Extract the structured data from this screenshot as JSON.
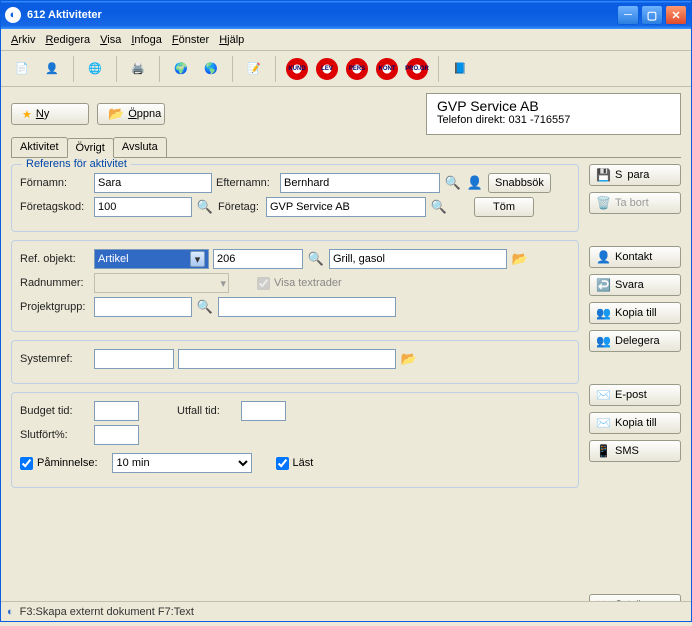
{
  "window": {
    "title": "612 Aktiviteter"
  },
  "menu": {
    "arkiv": "Arkiv",
    "redigera": "Redigera",
    "visa": "Visa",
    "infoga": "Infoga",
    "fonster": "Fönster",
    "hjalp": "Hjälp"
  },
  "toolbar_badges": [
    "KUND",
    "LEV",
    "PERS",
    "KONT",
    "PRO.GR"
  ],
  "topbuttons": {
    "ny": "Ny",
    "oppna": "Öppna"
  },
  "company": {
    "name": "GVP Service AB",
    "phone": "Telefon direkt:  031 -716557"
  },
  "tabs": {
    "aktivitet": "Aktivitet",
    "ovrigt": "Övrigt",
    "avsluta": "Avsluta"
  },
  "ref": {
    "legend": "Referens för aktivitet",
    "fornamn_lbl": "Förnamn:",
    "fornamn": "Sara",
    "efternamn_lbl": "Efternamn:",
    "efternamn": "Bernhard",
    "foretagskod_lbl": "Företagskod:",
    "foretagskod": "100",
    "foretag_lbl": "Företag:",
    "foretag": "GVP Service AB",
    "snabbsok": "Snabbsök",
    "tom": "Töm"
  },
  "obj": {
    "refobj_lbl": "Ref. objekt:",
    "refobj_sel": "Artikel",
    "refobj_code": "206",
    "refobj_desc": "Grill, gasol",
    "radnr_lbl": "Radnummer:",
    "visa_textrader": "Visa textrader",
    "projgrupp_lbl": "Projektgrupp:"
  },
  "sys": {
    "systemref_lbl": "Systemref:"
  },
  "bud": {
    "budget_lbl": "Budget tid:",
    "utfall_lbl": "Utfall tid:",
    "slutfort_lbl": "Slutfört%:",
    "paminnelse": "Påminnelse:",
    "paminnelse_val": "10 min",
    "last": "Läst"
  },
  "right": {
    "spara": "Spara",
    "tabort": "Ta bort",
    "kontakt": "Kontakt",
    "svara": "Svara",
    "kopia_till": "Kopia till",
    "delegera": "Delegera",
    "epost": "E-post",
    "kopia_till2": "Kopia till",
    "sms": "SMS",
    "stang": "Stäng"
  },
  "status": "F3:Skapa externt dokument  F7:Text"
}
